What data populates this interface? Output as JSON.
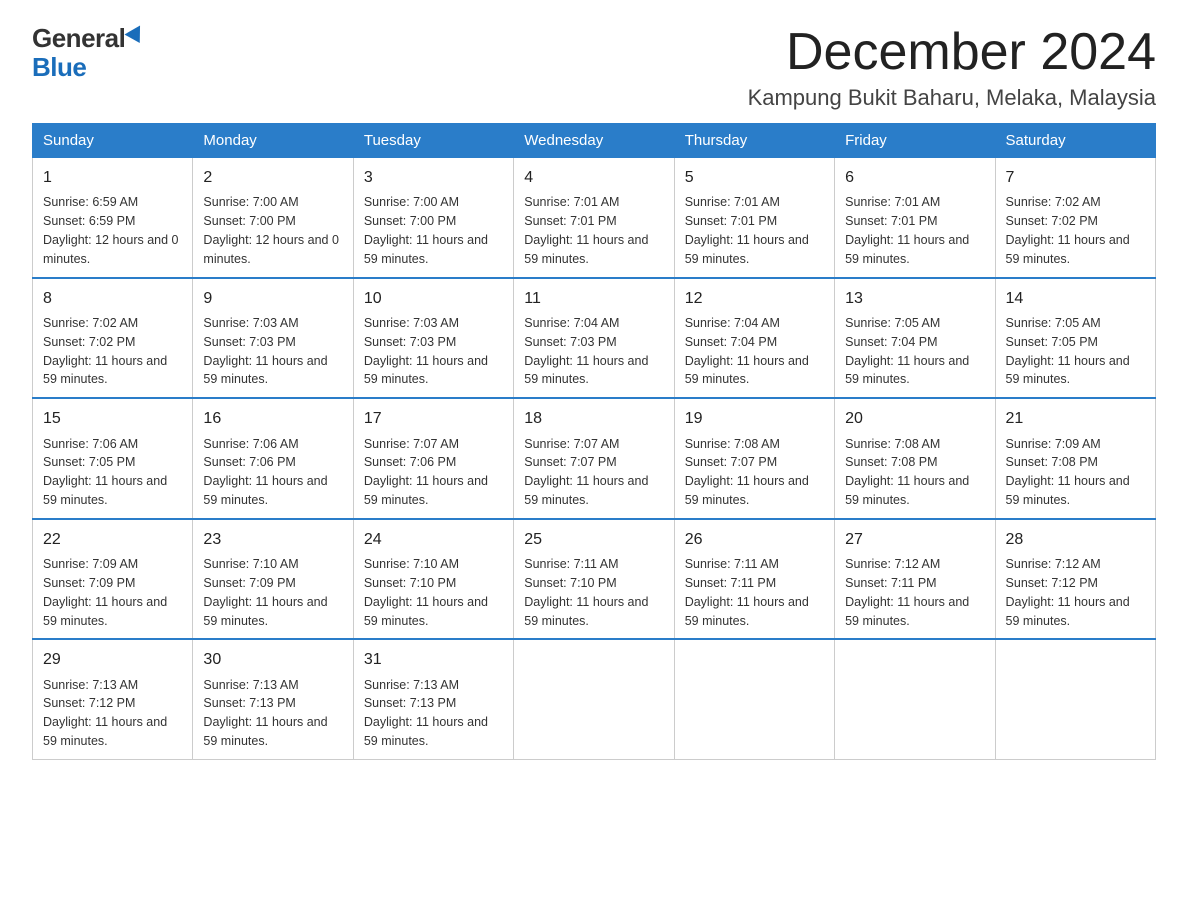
{
  "logo": {
    "general": "General",
    "blue": "Blue"
  },
  "header": {
    "month": "December 2024",
    "location": "Kampung Bukit Baharu, Melaka, Malaysia"
  },
  "weekdays": [
    "Sunday",
    "Monday",
    "Tuesday",
    "Wednesday",
    "Thursday",
    "Friday",
    "Saturday"
  ],
  "weeks": [
    [
      {
        "day": "1",
        "sunrise": "6:59 AM",
        "sunset": "6:59 PM",
        "daylight": "12 hours and 0 minutes."
      },
      {
        "day": "2",
        "sunrise": "7:00 AM",
        "sunset": "7:00 PM",
        "daylight": "12 hours and 0 minutes."
      },
      {
        "day": "3",
        "sunrise": "7:00 AM",
        "sunset": "7:00 PM",
        "daylight": "11 hours and 59 minutes."
      },
      {
        "day": "4",
        "sunrise": "7:01 AM",
        "sunset": "7:01 PM",
        "daylight": "11 hours and 59 minutes."
      },
      {
        "day": "5",
        "sunrise": "7:01 AM",
        "sunset": "7:01 PM",
        "daylight": "11 hours and 59 minutes."
      },
      {
        "day": "6",
        "sunrise": "7:01 AM",
        "sunset": "7:01 PM",
        "daylight": "11 hours and 59 minutes."
      },
      {
        "day": "7",
        "sunrise": "7:02 AM",
        "sunset": "7:02 PM",
        "daylight": "11 hours and 59 minutes."
      }
    ],
    [
      {
        "day": "8",
        "sunrise": "7:02 AM",
        "sunset": "7:02 PM",
        "daylight": "11 hours and 59 minutes."
      },
      {
        "day": "9",
        "sunrise": "7:03 AM",
        "sunset": "7:03 PM",
        "daylight": "11 hours and 59 minutes."
      },
      {
        "day": "10",
        "sunrise": "7:03 AM",
        "sunset": "7:03 PM",
        "daylight": "11 hours and 59 minutes."
      },
      {
        "day": "11",
        "sunrise": "7:04 AM",
        "sunset": "7:03 PM",
        "daylight": "11 hours and 59 minutes."
      },
      {
        "day": "12",
        "sunrise": "7:04 AM",
        "sunset": "7:04 PM",
        "daylight": "11 hours and 59 minutes."
      },
      {
        "day": "13",
        "sunrise": "7:05 AM",
        "sunset": "7:04 PM",
        "daylight": "11 hours and 59 minutes."
      },
      {
        "day": "14",
        "sunrise": "7:05 AM",
        "sunset": "7:05 PM",
        "daylight": "11 hours and 59 minutes."
      }
    ],
    [
      {
        "day": "15",
        "sunrise": "7:06 AM",
        "sunset": "7:05 PM",
        "daylight": "11 hours and 59 minutes."
      },
      {
        "day": "16",
        "sunrise": "7:06 AM",
        "sunset": "7:06 PM",
        "daylight": "11 hours and 59 minutes."
      },
      {
        "day": "17",
        "sunrise": "7:07 AM",
        "sunset": "7:06 PM",
        "daylight": "11 hours and 59 minutes."
      },
      {
        "day": "18",
        "sunrise": "7:07 AM",
        "sunset": "7:07 PM",
        "daylight": "11 hours and 59 minutes."
      },
      {
        "day": "19",
        "sunrise": "7:08 AM",
        "sunset": "7:07 PM",
        "daylight": "11 hours and 59 minutes."
      },
      {
        "day": "20",
        "sunrise": "7:08 AM",
        "sunset": "7:08 PM",
        "daylight": "11 hours and 59 minutes."
      },
      {
        "day": "21",
        "sunrise": "7:09 AM",
        "sunset": "7:08 PM",
        "daylight": "11 hours and 59 minutes."
      }
    ],
    [
      {
        "day": "22",
        "sunrise": "7:09 AM",
        "sunset": "7:09 PM",
        "daylight": "11 hours and 59 minutes."
      },
      {
        "day": "23",
        "sunrise": "7:10 AM",
        "sunset": "7:09 PM",
        "daylight": "11 hours and 59 minutes."
      },
      {
        "day": "24",
        "sunrise": "7:10 AM",
        "sunset": "7:10 PM",
        "daylight": "11 hours and 59 minutes."
      },
      {
        "day": "25",
        "sunrise": "7:11 AM",
        "sunset": "7:10 PM",
        "daylight": "11 hours and 59 minutes."
      },
      {
        "day": "26",
        "sunrise": "7:11 AM",
        "sunset": "7:11 PM",
        "daylight": "11 hours and 59 minutes."
      },
      {
        "day": "27",
        "sunrise": "7:12 AM",
        "sunset": "7:11 PM",
        "daylight": "11 hours and 59 minutes."
      },
      {
        "day": "28",
        "sunrise": "7:12 AM",
        "sunset": "7:12 PM",
        "daylight": "11 hours and 59 minutes."
      }
    ],
    [
      {
        "day": "29",
        "sunrise": "7:13 AM",
        "sunset": "7:12 PM",
        "daylight": "11 hours and 59 minutes."
      },
      {
        "day": "30",
        "sunrise": "7:13 AM",
        "sunset": "7:13 PM",
        "daylight": "11 hours and 59 minutes."
      },
      {
        "day": "31",
        "sunrise": "7:13 AM",
        "sunset": "7:13 PM",
        "daylight": "11 hours and 59 minutes."
      },
      null,
      null,
      null,
      null
    ]
  ]
}
